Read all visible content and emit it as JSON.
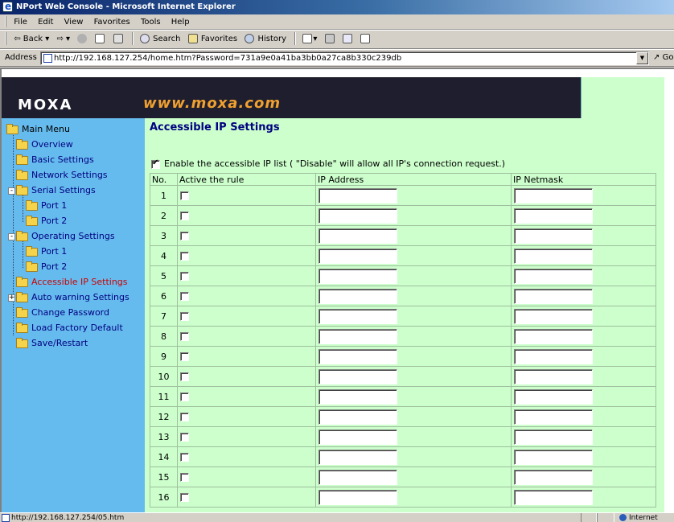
{
  "window": {
    "title": "NPort Web Console - Microsoft Internet Explorer"
  },
  "menubar": [
    "File",
    "Edit",
    "View",
    "Favorites",
    "Tools",
    "Help"
  ],
  "toolbar": {
    "back": "Back",
    "search": "Search",
    "favorites": "Favorites",
    "history": "History"
  },
  "address": {
    "label": "Address",
    "url": "http://192.168.127.254/home.htm?Password=731a9e0a41ba3bb0a27ca8b330c239db",
    "go": "Go"
  },
  "banner": {
    "logo": "MOXA",
    "site": "www.moxa.com"
  },
  "sidebar": {
    "root": "Main Menu",
    "items": [
      {
        "label": "Overview"
      },
      {
        "label": "Basic Settings"
      },
      {
        "label": "Network Settings"
      },
      {
        "label": "Serial Settings",
        "expander": "-"
      },
      {
        "label": "Port 1"
      },
      {
        "label": "Port 2"
      },
      {
        "label": "Operating Settings",
        "expander": "-"
      },
      {
        "label": "Port 1"
      },
      {
        "label": "Port 2"
      },
      {
        "label": "Accessible IP Settings",
        "active": true
      },
      {
        "label": "Auto warning Settings",
        "expander": "+"
      },
      {
        "label": "Change Password"
      },
      {
        "label": "Load Factory Default"
      },
      {
        "label": "Save/Restart"
      }
    ]
  },
  "content": {
    "title": "Accessible IP Settings",
    "enable_label": "Enable the accessible IP list ( \"Disable\" will allow all IP's connection request.)",
    "enable_checked": true,
    "columns": {
      "no": "No.",
      "active": "Active the rule",
      "ip": "IP Address",
      "netmask": "IP Netmask"
    },
    "rows": [
      "1",
      "2",
      "3",
      "4",
      "5",
      "6",
      "7",
      "8",
      "9",
      "10",
      "11",
      "12",
      "13",
      "14",
      "15",
      "16"
    ]
  },
  "statusbar": {
    "url": "http://192.168.127.254/05.htm",
    "zone": "Internet"
  },
  "colors": {
    "sidebar_bg": "#66bbee",
    "content_bg": "#ccffcc",
    "active_item": "#cc0000",
    "title_color": "#000080",
    "site_orange": "#f0a030"
  }
}
